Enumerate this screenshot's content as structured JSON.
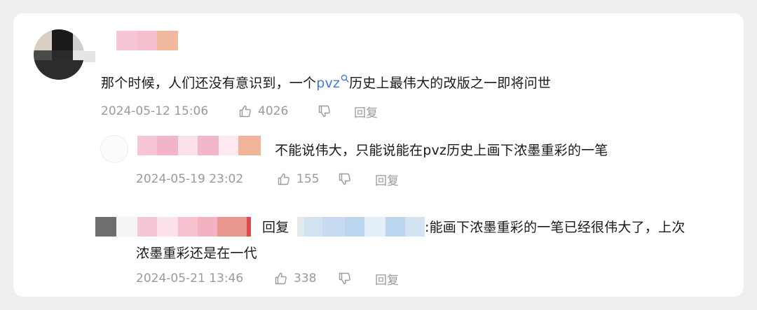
{
  "comments": [
    {
      "text_before": "那个时候，人们还没有意识到，一个",
      "link": "pvz",
      "text_after": "历史上最伟大的改版之一即将问世",
      "date": "2024-05-12 15:06",
      "likes": "4026",
      "reply_label": "回复"
    },
    {
      "text": "不能说伟大，只能说能在pvz历史上画下浓墨重彩的一笔",
      "date": "2024-05-19 23:02",
      "likes": "155",
      "reply_label": "回复"
    },
    {
      "reply_word": "回复",
      "text_line1": ":能画下浓墨重彩的一笔已经很伟大了，上次",
      "text_line2": "浓墨重彩还是在一代",
      "date": "2024-05-21 13:46",
      "likes": "338",
      "reply_label": "回复"
    }
  ],
  "colors": {
    "link": "#3d7bd6",
    "meta": "#9a9a9a",
    "text": "#1a1a1a"
  },
  "icons": [
    "search-icon",
    "thumbs-up-icon",
    "thumbs-down-icon"
  ]
}
